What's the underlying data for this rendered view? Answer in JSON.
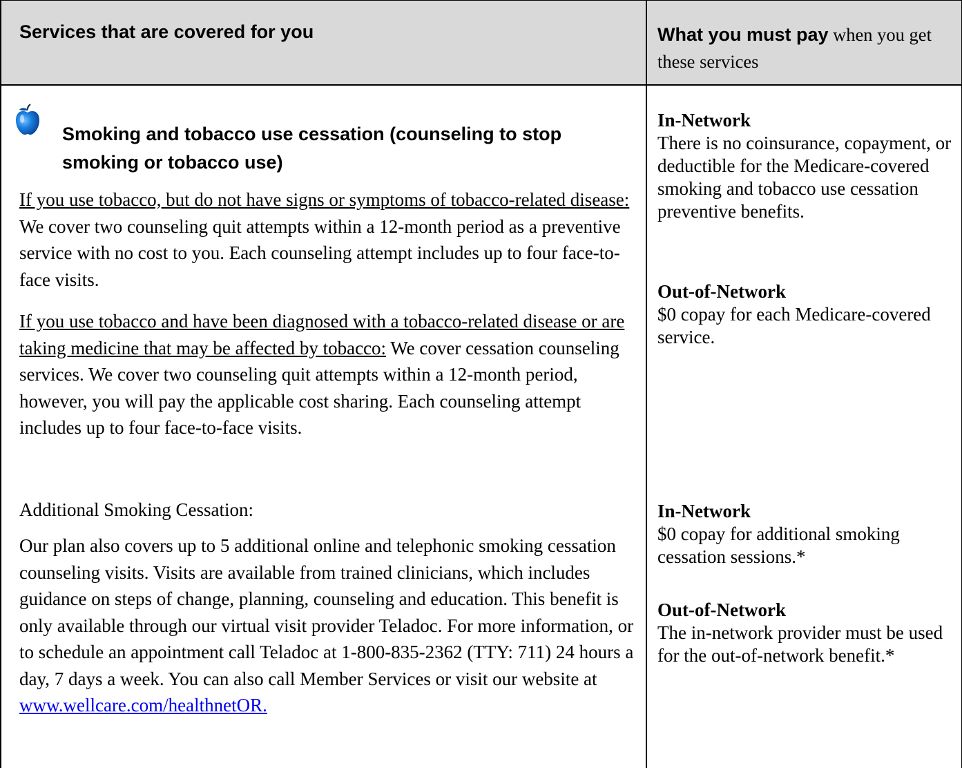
{
  "header": {
    "left_label": "Services that are covered for you",
    "right_label_bold": "What you must pay",
    "right_label_rest": " when you get these services"
  },
  "service": {
    "icon": "apple-icon",
    "title": "Smoking and tobacco use cessation (counseling to stop smoking or tobacco use)",
    "para1_underlined": "If you use tobacco, but do not have signs or symptoms of tobacco-related disease:",
    "para1_rest": " We cover two counseling quit attempts within a 12-month period as a preventive service with no cost to you. Each counseling attempt includes up to four face-to-face visits.",
    "para2_underlined": "If you use tobacco and have been diagnosed with a tobacco-related disease or are taking medicine that may be affected by tobacco:",
    "para2_rest": " We cover cessation counseling services. We cover two counseling quit attempts within a 12-month period, however, you will pay the applicable cost sharing. Each counseling attempt includes up to four face-to-face visits.",
    "additional_heading": "Additional Smoking Cessation:",
    "additional_text": "Our plan also covers up to 5 additional online and telephonic smoking cessation counseling visits. Visits are available from trained clinicians, which includes guidance on steps of change, planning, counseling and education. This benefit is only available through our virtual visit provider Teladoc. For more information, or to schedule an appointment call Teladoc at 1-800-835-2362 (TTY: 711) 24 hours a day, 7 days a week. You can also call Member Services or visit our website at ",
    "website_link": "www.wellcare.com/healthnetOR. "
  },
  "costs": {
    "block1": {
      "in_label": "In-Network",
      "in_text": "There is no coinsurance, copayment, or deductible for the Medicare-covered smoking and tobacco use cessation preventive benefits.",
      "out_label": "Out-of-Network",
      "out_text": "$0 copay for each Medicare-covered service."
    },
    "block2": {
      "in_label": "In-Network",
      "in_text": "$0 copay for additional smoking cessation sessions.*",
      "out_label": "Out-of-Network",
      "out_text": "The in-network provider must be used for the out-of-network benefit.*"
    }
  }
}
